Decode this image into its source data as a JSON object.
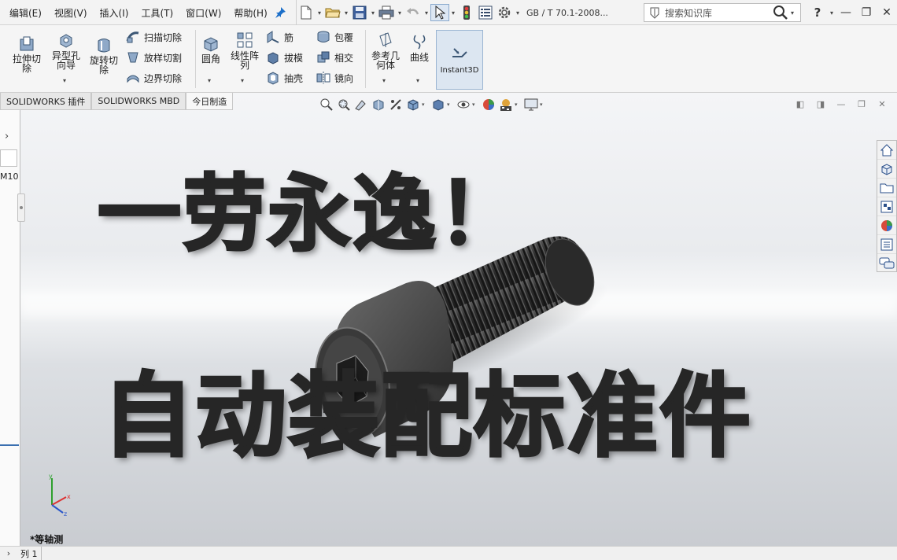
{
  "menubar": {
    "items": [
      "编辑(E)",
      "视图(V)",
      "插入(I)",
      "工具(T)",
      "窗口(W)",
      "帮助(H)"
    ]
  },
  "quick_access": {
    "standard_label": "GB / T 70.1-2008...",
    "icons": [
      "new-document-icon",
      "open-folder-icon",
      "save-icon",
      "print-icon",
      "undo-icon",
      "select-cursor-icon",
      "traffic-light-icon",
      "file-properties-icon",
      "options-gear-icon"
    ]
  },
  "search": {
    "placeholder": "搜索知识库"
  },
  "window_controls": {
    "help": "?",
    "minimize": "—",
    "restore": "❐",
    "close": "✕"
  },
  "ribbon": {
    "extruded_cut": "拉伸切除",
    "hole_wizard": "异型孔向导",
    "revolved_cut": "旋转切除",
    "swept_cut": "扫描切除",
    "lofted_cut": "放样切割",
    "boundary_cut": "边界切除",
    "fillet": "圆角",
    "linear_pattern": "线性阵列",
    "rib": "筋",
    "draft": "拔模",
    "shell": "抽壳",
    "wrap": "包覆",
    "intersect": "相交",
    "mirror": "镜向",
    "reference_geometry": "参考几何体",
    "curves": "曲线",
    "instant3d": "Instant3D"
  },
  "tabs": [
    "SOLIDWORKS 插件",
    "SOLIDWORKS MBD",
    "今日制造"
  ],
  "left_panel": {
    "text": "M10"
  },
  "overlay": {
    "title1": "一劳永逸！",
    "title2": "自动装配标准件"
  },
  "view_label": "*等轴测",
  "status_bar": {
    "tab": "列 1"
  },
  "colors": {
    "accent": "#3a6fb0",
    "viewport_top": "#f4f5f7",
    "viewport_bottom": "#c9ccd1",
    "title_text": "#262626"
  }
}
